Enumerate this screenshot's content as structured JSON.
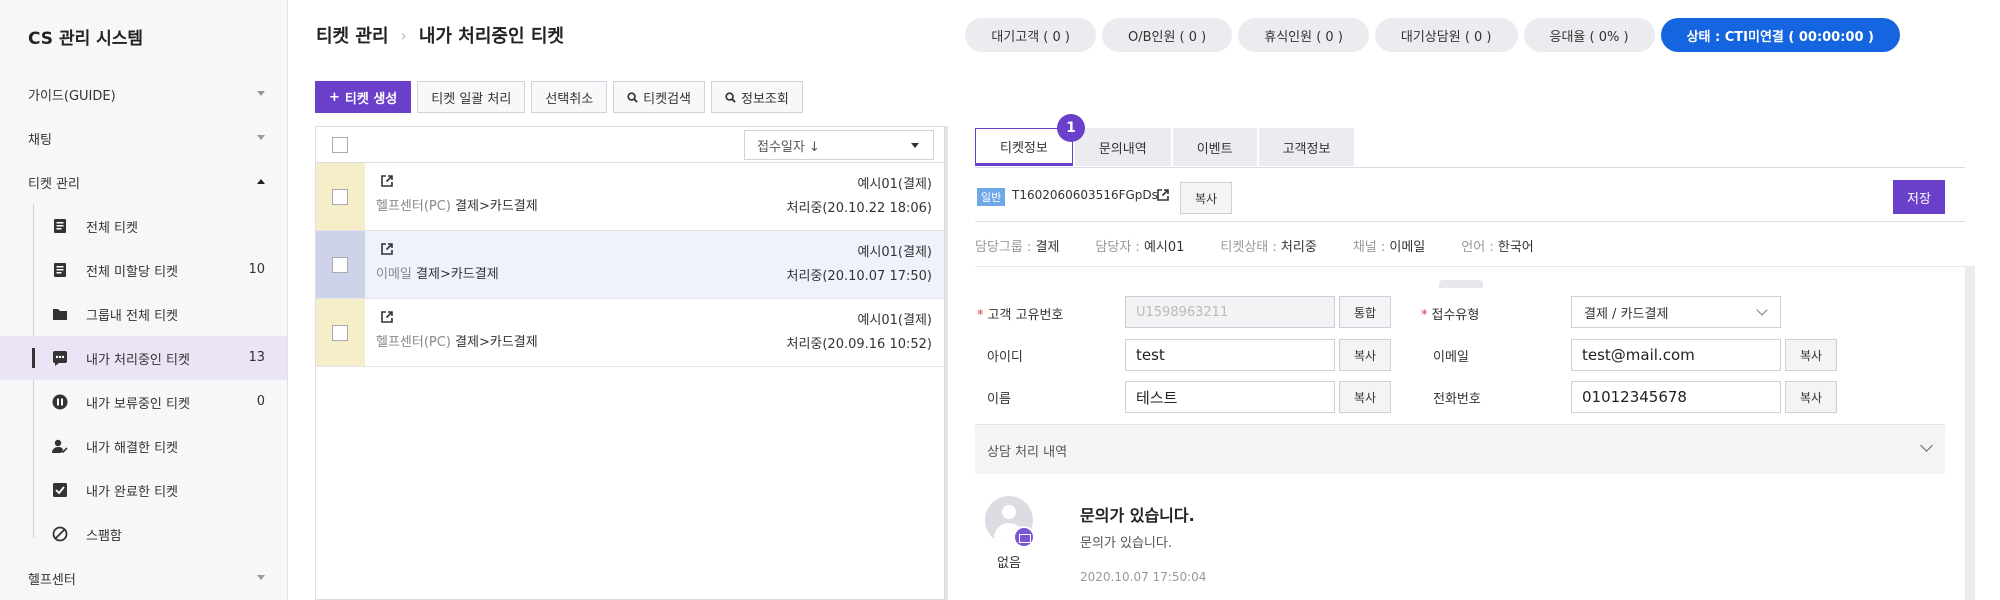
{
  "sidebar": {
    "brand": "CS 관리 시스템",
    "menus": [
      {
        "label": "가이드(GUIDE)"
      },
      {
        "label": "채팅"
      },
      {
        "label": "티켓 관리"
      }
    ],
    "ticket_sub": [
      {
        "label": "전체 티켓",
        "count": "",
        "icon": "document-icon"
      },
      {
        "label": "전체 미할당 티켓",
        "count": "10",
        "icon": "document-icon"
      },
      {
        "label": "그룹내 전체 티켓",
        "count": "",
        "icon": "folder-icon"
      },
      {
        "label": "내가 처리중인 티켓",
        "count": "13",
        "icon": "chat-dots-icon"
      },
      {
        "label": "내가 보류중인 티켓",
        "count": "0",
        "icon": "pause-icon"
      },
      {
        "label": "내가 해결한 티켓",
        "count": "",
        "icon": "user-check-icon"
      },
      {
        "label": "내가 완료한 티켓",
        "count": "",
        "icon": "checkbox-icon"
      },
      {
        "label": "스팸함",
        "count": "",
        "icon": "block-icon"
      }
    ],
    "helpcenter": "헬프센터"
  },
  "header": {
    "crumb_parent": "티켓 관리",
    "crumb_current": "내가 처리중인 티켓",
    "pills": [
      "대기고객 ( 0 )",
      "O/B인원 ( 0 )",
      "휴식인원 ( 0 )",
      "대기상담원 ( 0 )",
      "응대율 ( 0% )"
    ],
    "status": "상태 : CTI미연결 ( 00:00:00 )"
  },
  "toolbar": {
    "create": "티켓 생성",
    "batch": "티켓 일괄 처리",
    "deselect": "선택취소",
    "search": "티켓검색",
    "lookup": "정보조회"
  },
  "list": {
    "sort_label": "접수일자 ↓",
    "rows": [
      {
        "channel": "헬프센터(PC)",
        "category": "결제>카드결제",
        "assignee": "예시01(결제)",
        "state": "처리중(20.10.22 18:06)"
      },
      {
        "channel": "이메일",
        "category": "결제>카드결제",
        "assignee": "예시01(결제)",
        "state": "처리중(20.10.07 17:50)"
      },
      {
        "channel": "헬프센터(PC)",
        "category": "결제>카드결제",
        "assignee": "예시01(결제)",
        "state": "처리중(20.09.16 10:52)"
      }
    ]
  },
  "detail": {
    "tabs": [
      "티켓정보",
      "문의내역",
      "이벤트",
      "고객정보"
    ],
    "badge": "1",
    "tag": "일반",
    "ticket_id": "T1602060603516FGpDs",
    "copy": "복사",
    "save": "저장",
    "meta": [
      {
        "k": "담당그룹 : ",
        "v": "결제"
      },
      {
        "k": "담당자 : ",
        "v": "예시01"
      },
      {
        "k": "티켓상태 : ",
        "v": "처리중"
      },
      {
        "k": "채널 : ",
        "v": "이메일"
      },
      {
        "k": "언어 : ",
        "v": "한국어"
      }
    ],
    "fields": {
      "cust_id_label": "고객 고유번호",
      "cust_id_placeholder": "U1598963211",
      "merge": "통합",
      "recv_type_label": "접수유형",
      "recv_type_value": "결제 / 카드결제",
      "id_label": "아이디",
      "id_value": "test",
      "email_label": "이메일",
      "email_value": "test@mail.com",
      "name_label": "이름",
      "name_value": "테스트",
      "phone_label": "전화번호",
      "phone_value": "01012345678"
    },
    "section_title": "상담 처리 내역",
    "history": {
      "sender": "없음",
      "title": "문의가 있습니다.",
      "body": "문의가 있습니다.",
      "time": "2020.10.07 17:50:04"
    }
  }
}
